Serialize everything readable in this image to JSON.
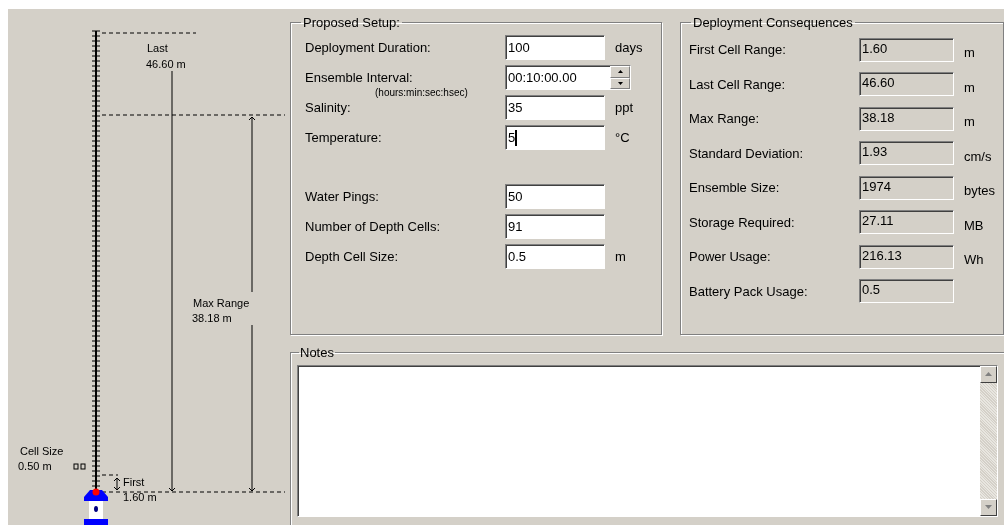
{
  "diagram": {
    "last_label": "Last",
    "last_value": "46.60 m",
    "max_label": "Max Range",
    "max_value": "38.18 m",
    "cell_label": "Cell Size",
    "cell_value": "0.50 m",
    "first_label": "First",
    "first_value": "1.60 m"
  },
  "proposed_setup": {
    "title": "Proposed Setup:",
    "environment": [
      {
        "kind": "text",
        "label": "Deployment Duration:",
        "value": "100",
        "unit": "days",
        "focused": false
      },
      {
        "kind": "spin",
        "label": "Ensemble Interval:",
        "value": "00:10:00.00",
        "hint": "(hours:min:sec:hsec)",
        "focused": false
      },
      {
        "kind": "text",
        "label": "Salinity:",
        "value": "35",
        "unit": "ppt",
        "focused": false
      },
      {
        "kind": "text",
        "label": "Temperature:",
        "value": "5",
        "unit": "°C",
        "focused": true
      }
    ],
    "cells": [
      {
        "kind": "text",
        "label": "Water Pings:",
        "value": "50",
        "focused": false
      },
      {
        "kind": "text",
        "label": "Number of Depth Cells:",
        "value": "91",
        "focused": false
      },
      {
        "kind": "text",
        "label": "Depth Cell Size:",
        "value": "0.5",
        "unit": "m",
        "focused": false
      }
    ]
  },
  "consequences": {
    "title": "Deployment Consequences",
    "rows": [
      {
        "label": "First Cell Range:",
        "value": "1.60",
        "unit": "m"
      },
      {
        "label": "Last Cell Range:",
        "value": "46.60",
        "unit": "m"
      },
      {
        "label": "Max Range:",
        "value": "38.18",
        "unit": "m"
      },
      {
        "label": "Standard Deviation:",
        "value": "1.93",
        "unit": "cm/s"
      },
      {
        "label": "Ensemble Size:",
        "value": "1974",
        "unit": "bytes"
      },
      {
        "label": "Storage Required:",
        "value": "27.11",
        "unit": "MB"
      },
      {
        "label": "Power Usage:",
        "value": "216.13",
        "unit": "Wh"
      },
      {
        "label": "Battery Pack Usage:",
        "value": "0.5"
      }
    ]
  },
  "notes": {
    "title": "Notes"
  }
}
